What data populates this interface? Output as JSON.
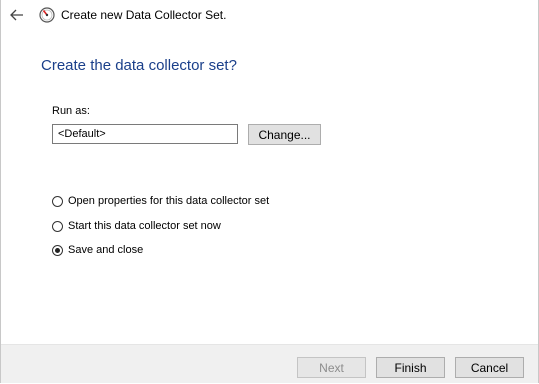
{
  "window": {
    "title": "Create new Data Collector Set."
  },
  "page": {
    "heading": "Create the data collector set?"
  },
  "run_as": {
    "label": "Run as:",
    "value": "<Default>",
    "change_button": "Change..."
  },
  "options": [
    {
      "label": "Open properties for this data collector set",
      "checked": false
    },
    {
      "label": "Start this data collector set now",
      "checked": false
    },
    {
      "label": "Save and close",
      "checked": true
    }
  ],
  "footer": {
    "next_label": "Next",
    "next_enabled": false,
    "finish_label": "Finish",
    "cancel_label": "Cancel"
  },
  "colors": {
    "heading": "#1a3f8a",
    "footer_bg": "#f0f0f0",
    "button_bg": "#e1e1e1"
  },
  "icons": {
    "back": "arrow-left-icon",
    "app": "performance-monitor-icon"
  }
}
